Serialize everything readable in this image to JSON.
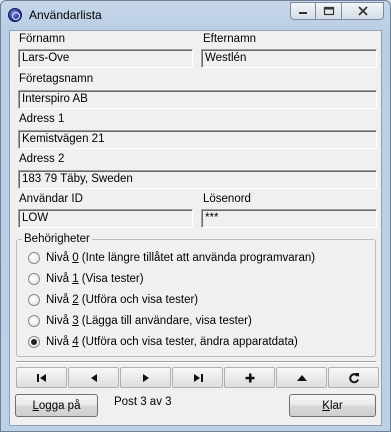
{
  "window": {
    "title": "Användarlista"
  },
  "titlebar_buttons": {
    "minimize": "▁",
    "maximize": "▢",
    "close": "✕"
  },
  "form": {
    "first_name_label": "Förnamn",
    "first_name_value": "Lars-Ove",
    "last_name_label": "Efternamn",
    "last_name_value": "Westlén",
    "company_label": "Företagsnamn",
    "company_value": "Interspiro AB",
    "address1_label": "Adress 1",
    "address1_value": "Kemistvägen 21",
    "address2_label": "Adress 2",
    "address2_value": "183 79 Täby, Sweden",
    "user_id_label": "Användar ID",
    "user_id_value": "LOW",
    "password_label": "Lösenord",
    "password_value": "***"
  },
  "permissions": {
    "title": "Behörigheter",
    "levels": [
      {
        "prefix": "Nivå ",
        "digit": "0",
        "desc": " (Inte längre tillåtet att använda programvaran)",
        "checked": false
      },
      {
        "prefix": "Nivå ",
        "digit": "1",
        "desc": " (Visa tester)",
        "checked": false
      },
      {
        "prefix": "Nivå ",
        "digit": "2",
        "desc": " (Utföra och visa tester)",
        "checked": false
      },
      {
        "prefix": "Nivå ",
        "digit": "3",
        "desc": " (Lägga till användare, visa tester)",
        "checked": false
      },
      {
        "prefix": "Nivå ",
        "digit": "4",
        "desc": " (Utföra och visa tester, ändra apparatdata)",
        "checked": true
      }
    ]
  },
  "nav_buttons": [
    "first-record-icon",
    "previous-record-icon",
    "next-record-icon",
    "last-record-icon",
    "add-record-icon",
    "edit-up-icon",
    "refresh-icon"
  ],
  "footer": {
    "login_label_first": "L",
    "login_label_rest": "ogga på",
    "status": "Post 3 av 3",
    "close_label_first": "K",
    "close_label_rest": "lar"
  }
}
